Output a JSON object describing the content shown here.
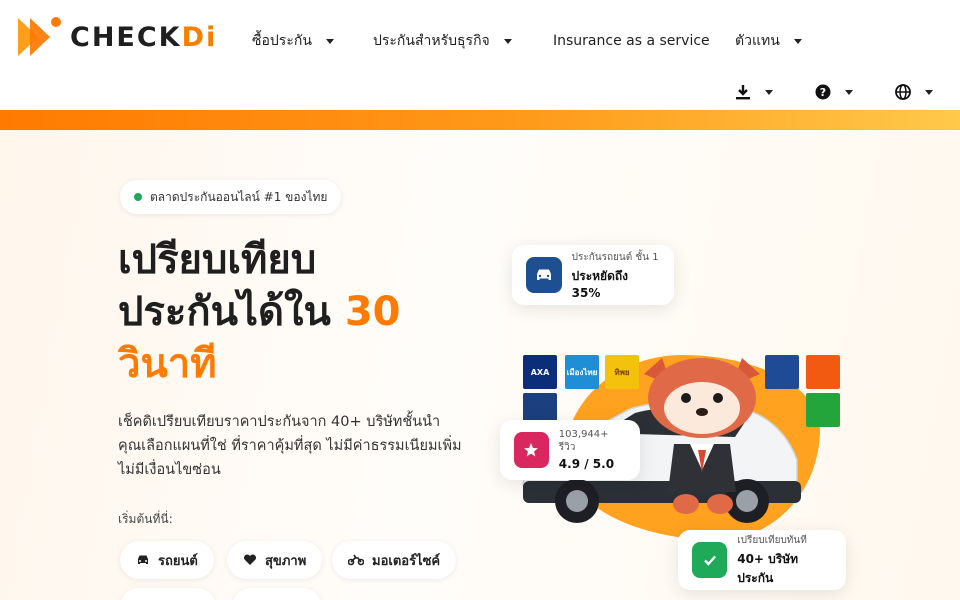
{
  "brand": {
    "name_main": "CHECK",
    "name_accent": "Di"
  },
  "nav": [
    {
      "label": "ซื้อประกัน",
      "has_dropdown": true
    },
    {
      "label": "ประกันสำหรับธุรกิจ",
      "has_dropdown": true
    },
    {
      "label": "Insurance as a service",
      "has_dropdown": false
    },
    {
      "label": "ตัวแทน",
      "has_dropdown": true
    }
  ],
  "utility": {
    "download_icon": "download-icon",
    "help_icon": "help-icon",
    "language_icon": "globe-icon"
  },
  "hero": {
    "badge": "ตลาดประกันออนไลน์ #1 ของไทย",
    "headline_line1": "เปรียบเทียบ",
    "headline_line2": "ประกันได้ใน ",
    "headline_accent_num": "30",
    "headline_accent_line3": "วินาที",
    "description": "เช็คดิเปรียบเทียบราคาประกันจาก 40+ บริษัทชั้นนำ คุณเลือกแผนที่ใช่ ที่ราคาคุ้มที่สุด ไม่มีค่าธรรมเนียมเพิ่ม ไม่มีเงื่อนไขซ่อน",
    "start_label": "เริ่มต้นที่นี่:",
    "categories": [
      {
        "label": "รถยนต์",
        "icon": "car-icon"
      },
      {
        "label": "สุขภาพ",
        "icon": "heart-icon"
      },
      {
        "label": "มอเตอร์ไซค์",
        "icon": "motorcycle-icon"
      }
    ]
  },
  "cards": {
    "savings": {
      "small": "ประกันรถยนต์ ชั้น 1",
      "big": "ประหยัดถึง 35%"
    },
    "reviews": {
      "small": "103,944+ รีวิว",
      "big": "4.9 / 5.0"
    },
    "compare": {
      "small": "เปรียบเทียบทันที",
      "big": "40+ บริษัทประกัน"
    }
  },
  "insurer_logos": [
    "AXA",
    "เมืองไทย",
    "ทิพย",
    "",
    "",
    "",
    ""
  ],
  "colors": {
    "accent": "#ff7a00",
    "green": "#1faa59",
    "navy": "#1d4f91",
    "pink": "#d8285f"
  }
}
